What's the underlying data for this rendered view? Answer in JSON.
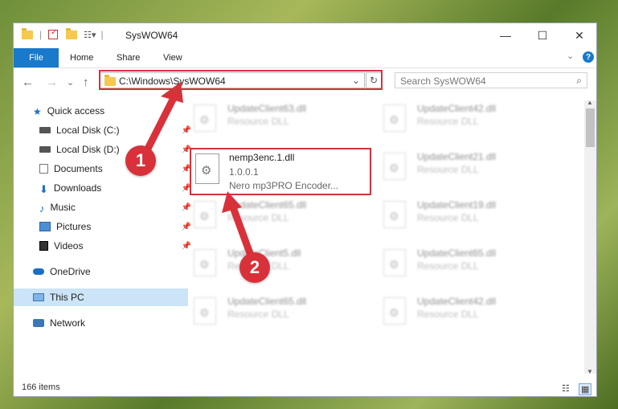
{
  "window": {
    "title": "SysWOW64",
    "controls": {
      "minimize": "—",
      "maximize": "☐",
      "close": "✕"
    }
  },
  "ribbon": {
    "file": "File",
    "tabs": [
      "Home",
      "Share",
      "View"
    ],
    "collapse": "⌄",
    "help": "?"
  },
  "address": {
    "path": "C:\\Windows\\SysWOW64",
    "dropdown": "⌄",
    "refresh": "↻",
    "search_placeholder": "Search SysWOW64",
    "back": "←",
    "forward": "→",
    "recent": "⌄",
    "up": "↑"
  },
  "sidebar": {
    "items": [
      {
        "label": "Quick access",
        "icon": "star-icon",
        "pinned": false
      },
      {
        "label": "Local Disk (C:)",
        "icon": "drive-icon",
        "pinned": true
      },
      {
        "label": "Local Disk (D:)",
        "icon": "drive-icon",
        "pinned": true
      },
      {
        "label": "Documents",
        "icon": "documents-icon",
        "pinned": true
      },
      {
        "label": "Downloads",
        "icon": "downloads-icon",
        "pinned": true
      },
      {
        "label": "Music",
        "icon": "music-icon",
        "pinned": true
      },
      {
        "label": "Pictures",
        "icon": "pictures-icon",
        "pinned": true
      },
      {
        "label": "Videos",
        "icon": "videos-icon",
        "pinned": true
      },
      {
        "label": "OneDrive",
        "icon": "cloud-icon",
        "pinned": false
      },
      {
        "label": "This PC",
        "icon": "computer-icon",
        "pinned": false,
        "selected": true
      },
      {
        "label": "Network",
        "icon": "network-icon",
        "pinned": false
      }
    ]
  },
  "files": {
    "left": [
      {
        "name": "UpdateClient63.dll",
        "desc": "Resource DLL"
      },
      {
        "name": "UpdateClient65.dll",
        "desc": "Resource DLL"
      },
      {
        "name": "UpdateClient5.dll",
        "desc": "Resource DLL"
      },
      {
        "name": "UpdateClient65.dll",
        "desc": "Resource DLL"
      }
    ],
    "right": [
      {
        "name": "UpdateClient42.dll",
        "desc": "Resource DLL"
      },
      {
        "name": "UpdateClient21.dll",
        "desc": "Resource DLL"
      },
      {
        "name": "UpdateClient19.dll",
        "desc": "Resource DLL"
      },
      {
        "name": "UpdateClient65.dll",
        "desc": "Resource DLL"
      },
      {
        "name": "UpdateClient42.dll",
        "desc": "Resource DLL"
      }
    ],
    "highlighted": {
      "name": "nemp3enc.1.dll",
      "version": "1.0.0.1",
      "desc": "Nero mp3PRO Encoder..."
    }
  },
  "status": {
    "count": "166 items"
  },
  "annotations": {
    "step1": "1",
    "step2": "2",
    "color": "#d9313a"
  }
}
